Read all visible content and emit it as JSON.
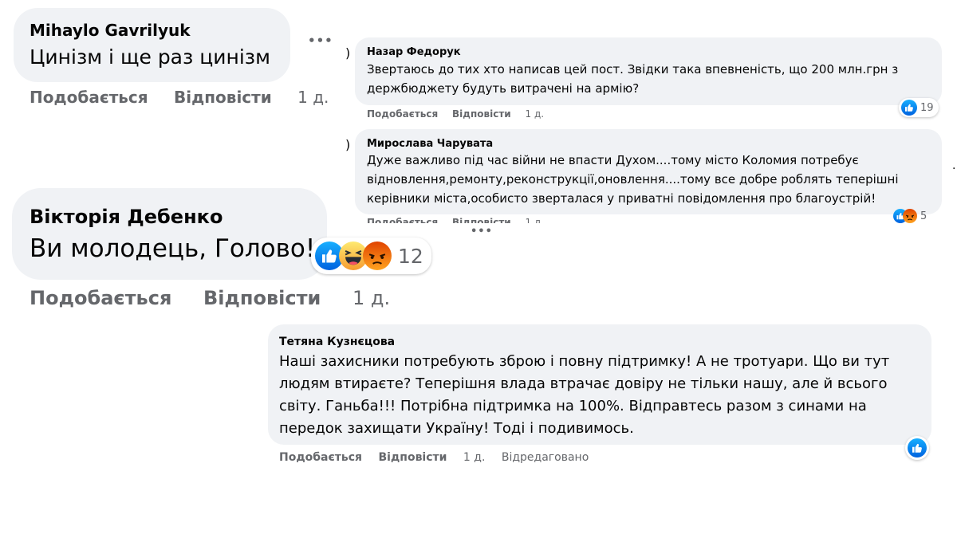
{
  "comments": {
    "c1": {
      "author": "Mihaylo Gavrilyuk",
      "text": "Цинізм і ще раз цинізм",
      "actions": {
        "like": "Подобається",
        "reply": "Відповісти",
        "time": "1 д."
      }
    },
    "c2": {
      "author": "Назар Федорук",
      "lines": [
        "Звертаюсь до тих хто написав цей пост. Звідки така впевненість, що 200 млн.грн з",
        "держбюджету будуть витрачені на армію?"
      ],
      "actions": {
        "like": "Подобається",
        "reply": "Відповісти",
        "time": "1 д."
      },
      "reactions": {
        "count": "19",
        "icons": [
          "like-icon"
        ]
      }
    },
    "c3": {
      "author": "Мирослава Чарувата",
      "lines": [
        "Дуже важливо під час війни не впасти Духом....тому місто Коломия потребує",
        "відновлення,ремонту,реконструкції,оновлення....тому все добре роблять теперішні",
        "керівники міста,особисто зверталася у приватні повідомлення про благоустрій!"
      ],
      "actions": {
        "like": "Подобається",
        "reply": "Відповісти",
        "time": "1 д."
      },
      "reactions": {
        "count": "5",
        "icons": [
          "like-icon",
          "angry-icon"
        ]
      }
    },
    "c4": {
      "author": "Вікторія Дебенко",
      "text": "Ви молодець, Голово!",
      "actions": {
        "like": "Подобається",
        "reply": "Відповісти",
        "time": "1 д."
      },
      "reactions": {
        "count": "12",
        "icons": [
          "like-icon",
          "haha-icon",
          "angry-icon"
        ]
      }
    },
    "c5": {
      "author": "Тетяна Кузнєцова",
      "lines": [
        "Наші захисники потребують зброю і повну підтримку! А не тротуари. Що ви тут",
        "людям втираєте? Теперішня влада втрачає довіру не тільки нашу, але й всього",
        "світу. Ганьба!!! Потрібна підтримка на 100%. Відправтесь разом з синами на",
        "передок захищати Україну! Тоді і подивимось."
      ],
      "actions": {
        "like": "Подобається",
        "reply": "Відповісти",
        "time": "1 д.",
        "edited": "Відредаговано"
      },
      "reactions": {
        "icons": [
          "like-icon"
        ]
      }
    }
  },
  "more_label": "•••",
  "colors": {
    "bubble": "#f0f2f5",
    "secondary_text": "#65676b",
    "like_blue": "#1877f2",
    "angry_orange": "#e9710f",
    "haha_yellow": "#f7b125"
  }
}
